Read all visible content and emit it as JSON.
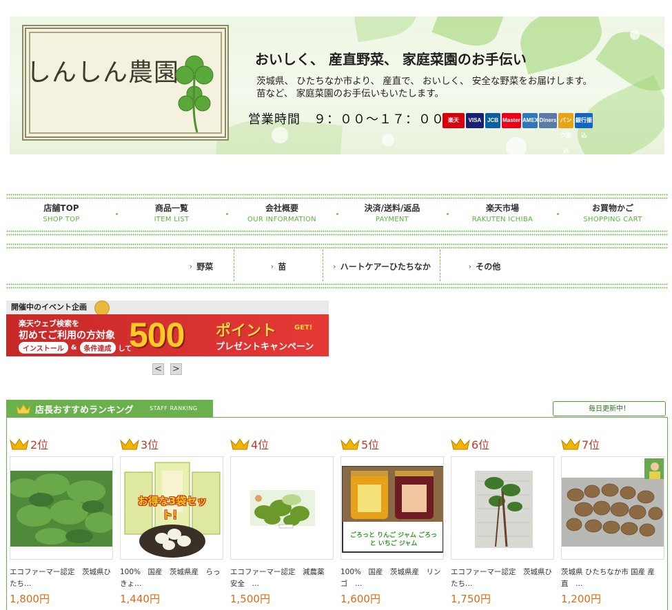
{
  "header": {
    "logo": "しんしん農園",
    "tagline": "おいしく、 産直野菜、 家庭菜園のお手伝い",
    "description_line1": "茨城県、 ひたちなか市より、 産直で、 おいしく、 安全な野菜をお届けします。",
    "description_line2": "苗など、 家庭菜園のお手伝いもいたします。",
    "hours": "営業時間　９：００～１７：００",
    "payments": [
      {
        "label": "楽天",
        "color": "#d7000f"
      },
      {
        "label": "VISA",
        "color": "#1a1f71"
      },
      {
        "label": "JCB",
        "color": "#0b5fa5"
      },
      {
        "label": "Master",
        "color": "#eb001b"
      },
      {
        "label": "AMEX",
        "color": "#2e77bb"
      },
      {
        "label": "Diners",
        "color": "#5b7aa8"
      },
      {
        "label": "バンク振込",
        "color": "#e8a317"
      },
      {
        "label": "銀行振込",
        "color": "#1565c0"
      }
    ]
  },
  "nav": {
    "items": [
      {
        "jp": "店舗TOP",
        "en": "SHOP TOP"
      },
      {
        "jp": "商品一覧",
        "en": "ITEM LIST"
      },
      {
        "jp": "会社概要",
        "en": "OUR INFORMATION"
      },
      {
        "jp": "決済/送料/返品",
        "en": "PAYMENT"
      },
      {
        "jp": "楽天市場",
        "en": "RAKUTEN ICHIBA"
      },
      {
        "jp": "お買物かご",
        "en": "SHOPPING CART"
      }
    ]
  },
  "categories": [
    "野菜",
    "苗",
    "ハートケアーひたちなか",
    "その他"
  ],
  "event": {
    "title": "開催中のイベント企画",
    "line1": "楽天ウェブ検索を",
    "line2": "初めてご利用の方対象",
    "install": "インストール",
    "amp": "&",
    "condition": "条件達成",
    "shite": "して",
    "big_number": "500",
    "point": "ポイント",
    "get": "GET!",
    "campaign": "プレゼントキャンペーン",
    "prev": "<",
    "next": ">"
  },
  "ranking": {
    "title": "店長おすすめランキング",
    "subtitle": "STAFF RANKING",
    "daily_update": "毎日更新中！",
    "items": [
      {
        "rank": "2位",
        "name": "エコファーマー認定　茨城県ひたち…",
        "price": "1,800円"
      },
      {
        "rank": "3位",
        "name": "100%　国産　茨城県産　らっきょ…",
        "price": "1,440円"
      },
      {
        "rank": "4位",
        "name": "エコファーマー認定　減農薬　安全　…",
        "price": "1,500円"
      },
      {
        "rank": "5位",
        "name": "100%　国産　茨城県産　リンゴ　…",
        "price": "1,600円"
      },
      {
        "rank": "6位",
        "name": "エコファーマー認定　茨城県ひたち…",
        "price": "1,750円"
      },
      {
        "rank": "7位",
        "name": "茨城県 ひたちなか市 国産 産直　…",
        "price": "1,200円"
      }
    ],
    "thumb3_caption": "お得な3袋セット！",
    "thumb5_caption": "ごろっと りんご ジャム ごろっと いちご ジャム"
  }
}
